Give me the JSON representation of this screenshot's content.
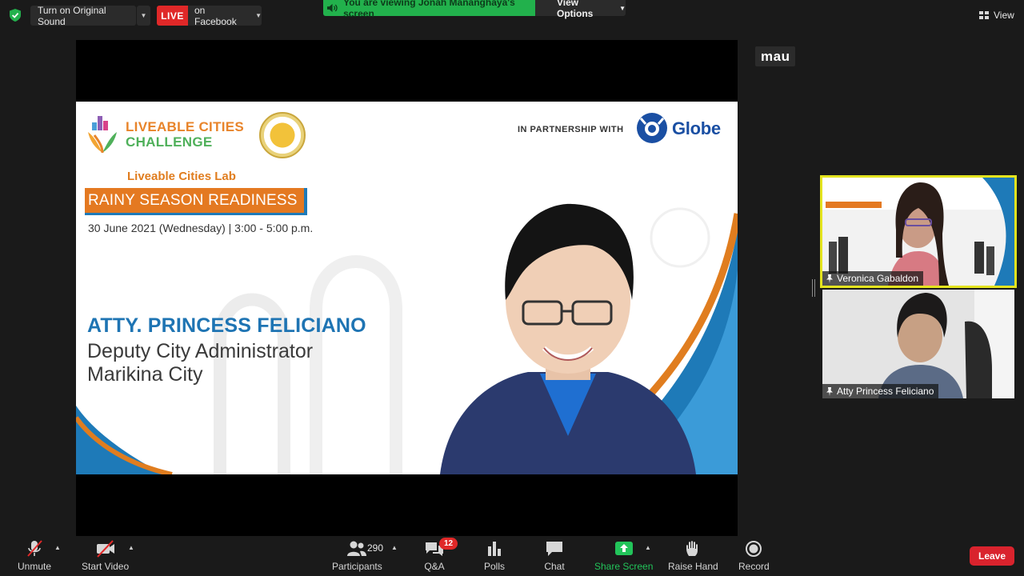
{
  "topbar": {
    "original_sound_label": "Turn on Original Sound",
    "live_badge": "LIVE",
    "live_target": "on Facebook",
    "viewing_banner": "You are viewing Jonah Mananghaya's screen",
    "view_options": "View Options",
    "view_label": "View"
  },
  "presenter_label": "mau",
  "slide": {
    "brand_line1": "LIVEABLE CITIES",
    "brand_line2": "CHALLENGE",
    "partnership": "IN PARTNERSHIP WITH",
    "partner_name": "Globe",
    "lab_title": "Liveable Cities Lab",
    "session_title": "RAINY SEASON READINESS",
    "date_line": "30 June 2021 (Wednesday) |  3:00 - 5:00 p.m.",
    "speaker_name": "ATTY. PRINCESS FELICIANO",
    "speaker_role": "Deputy City Administrator",
    "speaker_city": "Marikina City"
  },
  "thumbnails": [
    {
      "name": "Veronica Gabaldon"
    },
    {
      "name": "Atty Princess Feliciano"
    }
  ],
  "toolbar": {
    "unmute": "Unmute",
    "start_video": "Start Video",
    "participants": "Participants",
    "participants_count": "290",
    "qa": "Q&A",
    "qa_badge": "12",
    "polls": "Polls",
    "chat": "Chat",
    "share_screen": "Share Screen",
    "raise_hand": "Raise Hand",
    "record": "Record",
    "leave": "Leave"
  },
  "colors": {
    "live_red": "#e02828",
    "banner_green": "#22b14c",
    "share_green": "#22c45a",
    "leave_red": "#d9232d",
    "active_speaker_border": "#e3e31e",
    "slide_orange": "#e47921",
    "slide_blue": "#1e74b3"
  }
}
